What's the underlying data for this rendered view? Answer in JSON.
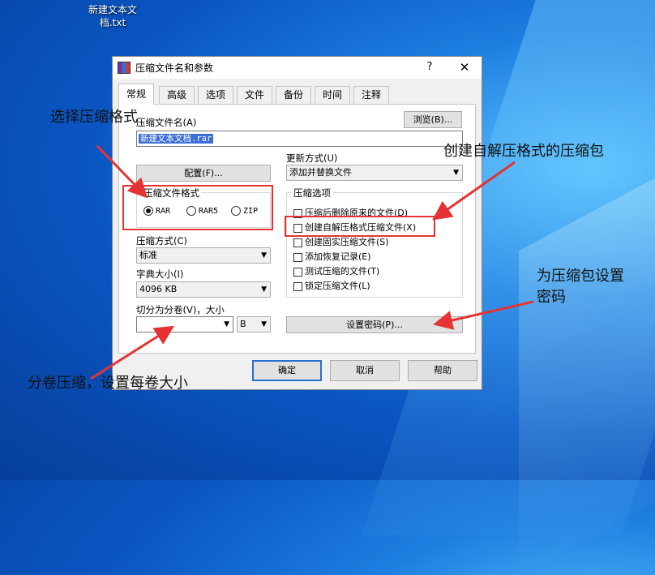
{
  "desktop": {
    "file_name_line1": "新建文本文",
    "file_name_line2": "档.txt"
  },
  "dialog": {
    "title": "压缩文件名和参数",
    "help": "?",
    "close": "✕",
    "tabs": [
      "常规",
      "高级",
      "选项",
      "文件",
      "备份",
      "时间",
      "注释"
    ],
    "archive_name_label": "压缩文件名(A)",
    "browse_button": "浏览(B)...",
    "archive_name_value": "新建文本文档.rar",
    "update_mode_label": "更新方式(U)",
    "update_mode_value": "添加并替换文件",
    "profile_button": "配置(F)...",
    "format_group_title": "压缩文件格式",
    "formats": [
      {
        "label": "RAR",
        "selected": true
      },
      {
        "label": "RAR5",
        "selected": false
      },
      {
        "label": "ZIP",
        "selected": false
      }
    ],
    "options_group_title": "压缩选项",
    "options": [
      {
        "label": "压缩后删除原来的文件(D)",
        "checked": false
      },
      {
        "label": "创建自解压格式压缩文件(X)",
        "checked": false
      },
      {
        "label": "创建固实压缩文件(S)",
        "checked": false
      },
      {
        "label": "添加恢复记录(E)",
        "checked": false
      },
      {
        "label": "测试压缩的文件(T)",
        "checked": false
      },
      {
        "label": "锁定压缩文件(L)",
        "checked": false
      }
    ],
    "method_label": "压缩方式(C)",
    "method_value": "标准",
    "dict_label": "字典大小(I)",
    "dict_value": "4096 KB",
    "split_label": "切分为分卷(V)，大小",
    "split_value": "",
    "split_unit": "B",
    "password_button": "设置密码(P)...",
    "ok_button": "确定",
    "cancel_button": "取消",
    "help_button": "帮助"
  },
  "annotations": {
    "format": "选择压缩格式",
    "sfx": "创建自解压格式的压缩包",
    "password_line1": "为压缩包设置",
    "password_line2": "密码",
    "split": "分卷压缩，设置每卷大小"
  },
  "colors": {
    "annotation_red": "#e53333",
    "selection_blue": "#3b6fd6",
    "desktop_blue": "#0a55c2"
  }
}
